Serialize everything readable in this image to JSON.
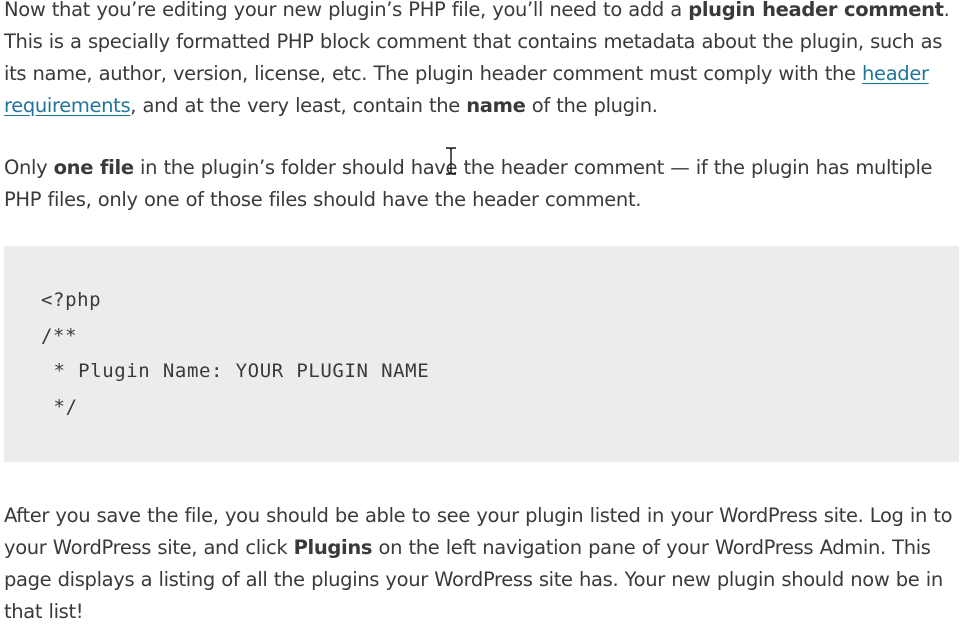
{
  "paragraph1": {
    "t1": "Now that you’re editing your new plugin’s PHP file, you’ll need to add a ",
    "b1": "plugin header comment",
    "t2": ". This is a specially formatted PHP block comment that contains metadata about the plugin, such as its name, author, version, license, etc. The plugin header comment must comply with the ",
    "link": "header requirements",
    "t3": ", and at the very least, contain the ",
    "b2": "name",
    "t4": " of the plugin."
  },
  "paragraph2": {
    "t1": "Only ",
    "b1": "one file",
    "t2": " in the plugin’s folder should have the header comment — if the plugin has multiple PHP files, only one of those files should have the header comment."
  },
  "code": {
    "lines": [
      "<?php",
      "/**",
      " * Plugin Name: YOUR PLUGIN NAME",
      " */"
    ]
  },
  "paragraph3": {
    "t1": "After you save the file, you should be able to see your plugin listed in your WordPress site. Log in to your WordPress site, and click ",
    "b1": "Plugins",
    "t2": " on the left navigation pane of your WordPress Admin. This page displays a listing of all the plugins your WordPress site has. Your new plugin should now be in that list!"
  },
  "colors": {
    "text": "#3a3a3a",
    "link": "#21759b",
    "code_background": "#ececec"
  },
  "cursor": "text-cursor-icon"
}
